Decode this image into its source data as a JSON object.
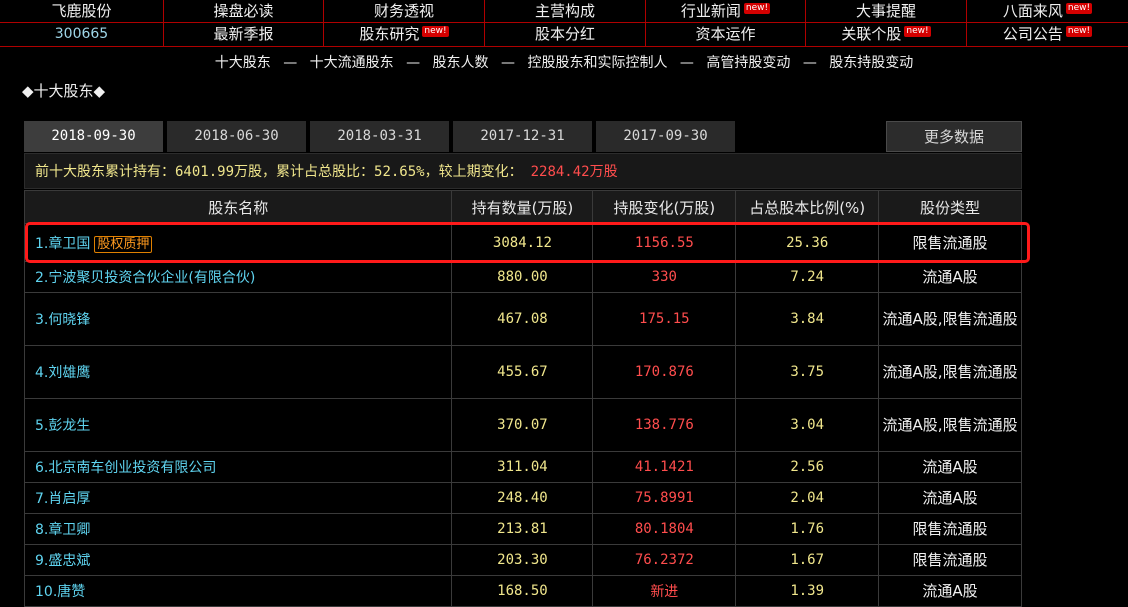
{
  "nav": {
    "stock_name": "飞鹿股份",
    "stock_code": "300665",
    "row1": [
      {
        "label": "操盘必读",
        "new": false
      },
      {
        "label": "财务透视",
        "new": false
      },
      {
        "label": "主营构成",
        "new": false
      },
      {
        "label": "行业新闻",
        "new": true
      },
      {
        "label": "大事提醒",
        "new": false
      },
      {
        "label": "八面来风",
        "new": true
      }
    ],
    "row2": [
      {
        "label": "最新季报",
        "new": false
      },
      {
        "label": "股东研究",
        "new": true
      },
      {
        "label": "股本分红",
        "new": false
      },
      {
        "label": "资本运作",
        "new": false
      },
      {
        "label": "关联个股",
        "new": true
      },
      {
        "label": "公司公告",
        "new": true
      }
    ],
    "new_badge": "new!"
  },
  "subnav": {
    "items": [
      "十大股东",
      "十大流通股东",
      "股东人数",
      "控股股东和实际控制人",
      "高管持股变动",
      "股东持股变动"
    ],
    "separator": "—"
  },
  "section_title": "◆十大股东◆",
  "tabs": [
    "2018-09-30",
    "2018-06-30",
    "2018-03-31",
    "2017-12-31",
    "2017-09-30"
  ],
  "more_label": "更多数据",
  "summary": {
    "label_hold": "前十大股东累计持有：",
    "hold": "6401.99万股",
    "label_ratio": "，累计占总股比：",
    "ratio": "52.65%",
    "label_change": "，较上期变化：",
    "change": "2284.42万股"
  },
  "table": {
    "headers": [
      "股东名称",
      "持有数量(万股)",
      "持股变化(万股)",
      "占总股本比例(%)",
      "股份类型"
    ],
    "rows": [
      {
        "name": "1.章卫国",
        "tag": "股权质押",
        "hold": "3084.12",
        "change": "1156.55",
        "ratio": "25.36",
        "type": "限售流通股"
      },
      {
        "name": "2.宁波聚贝投资合伙企业(有限合伙)",
        "tag": "",
        "hold": "880.00",
        "change": "330",
        "ratio": "7.24",
        "type": "流通A股"
      },
      {
        "name": "3.何晓锋",
        "tag": "",
        "hold": "467.08",
        "change": "175.15",
        "ratio": "3.84",
        "type": "流通A股,限售流通股"
      },
      {
        "name": "4.刘雄鹰",
        "tag": "",
        "hold": "455.67",
        "change": "170.876",
        "ratio": "3.75",
        "type": "流通A股,限售流通股"
      },
      {
        "name": "5.彭龙生",
        "tag": "",
        "hold": "370.07",
        "change": "138.776",
        "ratio": "3.04",
        "type": "流通A股,限售流通股"
      },
      {
        "name": "6.北京南车创业投资有限公司",
        "tag": "",
        "hold": "311.04",
        "change": "41.1421",
        "ratio": "2.56",
        "type": "流通A股"
      },
      {
        "name": "7.肖启厚",
        "tag": "",
        "hold": "248.40",
        "change": "75.8991",
        "ratio": "2.04",
        "type": "流通A股"
      },
      {
        "name": "8.章卫卿",
        "tag": "",
        "hold": "213.81",
        "change": "80.1804",
        "ratio": "1.76",
        "type": "限售流通股"
      },
      {
        "name": "9.盛忠斌",
        "tag": "",
        "hold": "203.30",
        "change": "76.2372",
        "ratio": "1.67",
        "type": "限售流通股"
      },
      {
        "name": "10.唐赞",
        "tag": "",
        "hold": "168.50",
        "change": "新进",
        "ratio": "1.39",
        "type": "流通A股"
      }
    ]
  },
  "colors": {
    "accent_red": "#ff1a1a",
    "name_cyan": "#5fd4f0",
    "value_yellow": "#f0e68c",
    "change_red": "#ff4d4d",
    "pledge_orange": "#ff9a1f"
  }
}
